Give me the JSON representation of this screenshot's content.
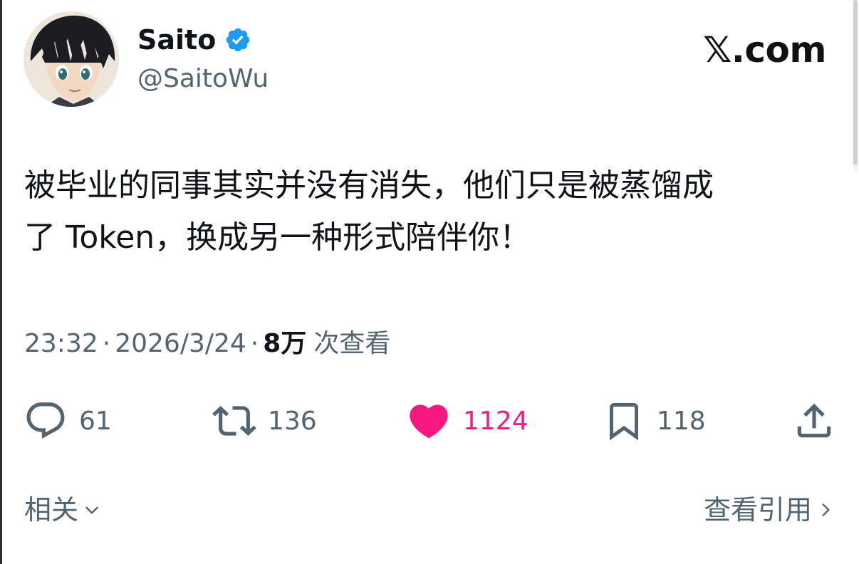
{
  "author": {
    "display_name": "Saito",
    "handle": "@SaitoWu",
    "verified": true,
    "avatar_icon": "anime-avatar"
  },
  "brand": "𝕏.com",
  "tweet": {
    "line1": "被毕业的同事其实并没有消失，他们只是被蒸馏成",
    "line2": "了 Token，换成另一种形式陪伴你！"
  },
  "meta": {
    "time": "23:32",
    "date": "2026/3/24",
    "views_count": "8万",
    "views_label": "次查看"
  },
  "actions": {
    "reply": {
      "icon": "reply-icon",
      "count": "61"
    },
    "repost": {
      "icon": "repost-icon",
      "count": "136"
    },
    "like": {
      "icon": "heart-icon",
      "count": "1124",
      "liked": true
    },
    "bookmark": {
      "icon": "bookmark-icon",
      "count": "118"
    },
    "share": {
      "icon": "share-icon"
    }
  },
  "footer": {
    "related_label": "相关",
    "view_quotes_label": "查看引用"
  },
  "colors": {
    "text": "#0f1419",
    "secondary": "#536471",
    "like": "#f91880",
    "verified": "#1d9bf0"
  }
}
